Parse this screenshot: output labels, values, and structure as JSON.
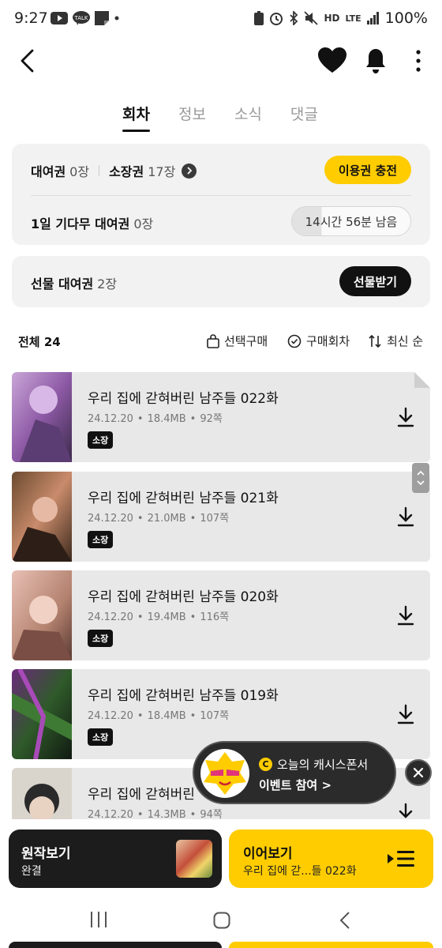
{
  "status_bar": {
    "time": "9:27",
    "battery": "100%",
    "left_icons": [
      "youtube-icon",
      "talk-icon",
      "note-icon",
      "dot-icon"
    ],
    "right_icons": [
      "data-saver-icon",
      "alarm-icon",
      "bluetooth-icon",
      "mute-icon",
      "hd-voice-icon",
      "lte-icon",
      "signal-icon"
    ],
    "hd_label": "HD",
    "lte_label": "LTE"
  },
  "nav": {
    "back_icon": "back-arrow-icon",
    "heart_icon": "heart-icon",
    "bell_icon": "bell-icon",
    "more_icon": "more-vertical-icon"
  },
  "tabs": [
    {
      "label": "회차",
      "active": true
    },
    {
      "label": "정보",
      "active": false
    },
    {
      "label": "소식",
      "active": false
    },
    {
      "label": "댓글",
      "active": false
    }
  ],
  "tickets": {
    "rental_label": "대여권",
    "rental_value": "0장",
    "own_label": "소장권",
    "own_value": "17장",
    "charge_button": "이용권 충전",
    "wait_label": "1일 기다무 대여권",
    "wait_value": "0장",
    "wait_time": "14시간 56분 남음",
    "wait_progress": 0.25
  },
  "gift": {
    "label": "선물 대여권",
    "value": "2장",
    "button": "선물받기"
  },
  "list_header": {
    "total": "전체 24",
    "select_buy": "선택구매",
    "purchased": "구매회차",
    "sort": "최신 순"
  },
  "episodes": [
    {
      "title": "우리 집에 갇혀버린 남주들 022화",
      "date": "24.12.20",
      "size": "18.4MB",
      "pages": "92쪽",
      "badge": "소장"
    },
    {
      "title": "우리 집에 갇혀버린 남주들 021화",
      "date": "24.12.20",
      "size": "21.0MB",
      "pages": "107쪽",
      "badge": "소장"
    },
    {
      "title": "우리 집에 갇혀버린 남주들 020화",
      "date": "24.12.20",
      "size": "19.4MB",
      "pages": "116쪽",
      "badge": "소장"
    },
    {
      "title": "우리 집에 갇혀버린 남주들 019화",
      "date": "24.12.20",
      "size": "18.4MB",
      "pages": "107쪽",
      "badge": "소장"
    },
    {
      "title": "우리 집에 갇혀버린",
      "date": "24.12.20",
      "size": "14.3MB",
      "pages": "94쪽",
      "badge": ""
    }
  ],
  "event": {
    "line1": "오늘의 캐시스폰서",
    "line2": "이벤트 참여 >",
    "cash_letter": "C"
  },
  "bottom": {
    "original_title": "원작보기",
    "original_sub": "완결",
    "continue_title": "이어보기",
    "continue_sub": "우리 집에 갇...들 022화"
  },
  "colors": {
    "accent": "#ffcc00",
    "dark": "#111111",
    "card_bg": "#f2f2f2"
  }
}
